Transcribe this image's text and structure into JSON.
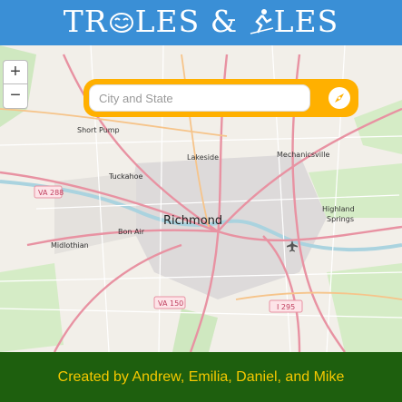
{
  "header": {
    "title_part1": "TR",
    "title_part2": "LES & ",
    "title_part3": "LES",
    "title_aria": "TROLLES & SKILES",
    "background": "#3a8fd6",
    "icon_left": "troll-face-icon",
    "icon_right": "skier-icon"
  },
  "map": {
    "zoom_in": "+",
    "zoom_out": "−",
    "labels": {
      "short_pump": "Short Pump",
      "lakeside": "Lakeside",
      "mechanicsville": "Mechanicsville",
      "tuckahoe": "Tuckahoe",
      "highland_springs_1": "Highland",
      "highland_springs_2": "Springs",
      "richmond": "Richmond",
      "bon_air": "Bon Air",
      "midlothian": "Midlothian"
    },
    "shields": {
      "va288": "VA 288",
      "va150": "VA 150",
      "i295": "I 295"
    },
    "airport_icon": "airport-icon"
  },
  "search": {
    "placeholder": "City and State",
    "value": "",
    "accent": "#ffb000",
    "button_icon": "compass-icon"
  },
  "footer": {
    "credits": "Created by Andrew, Emilia, Daniel, and Mike",
    "background": "#1e5f0e",
    "text_color": "#f5c800"
  }
}
